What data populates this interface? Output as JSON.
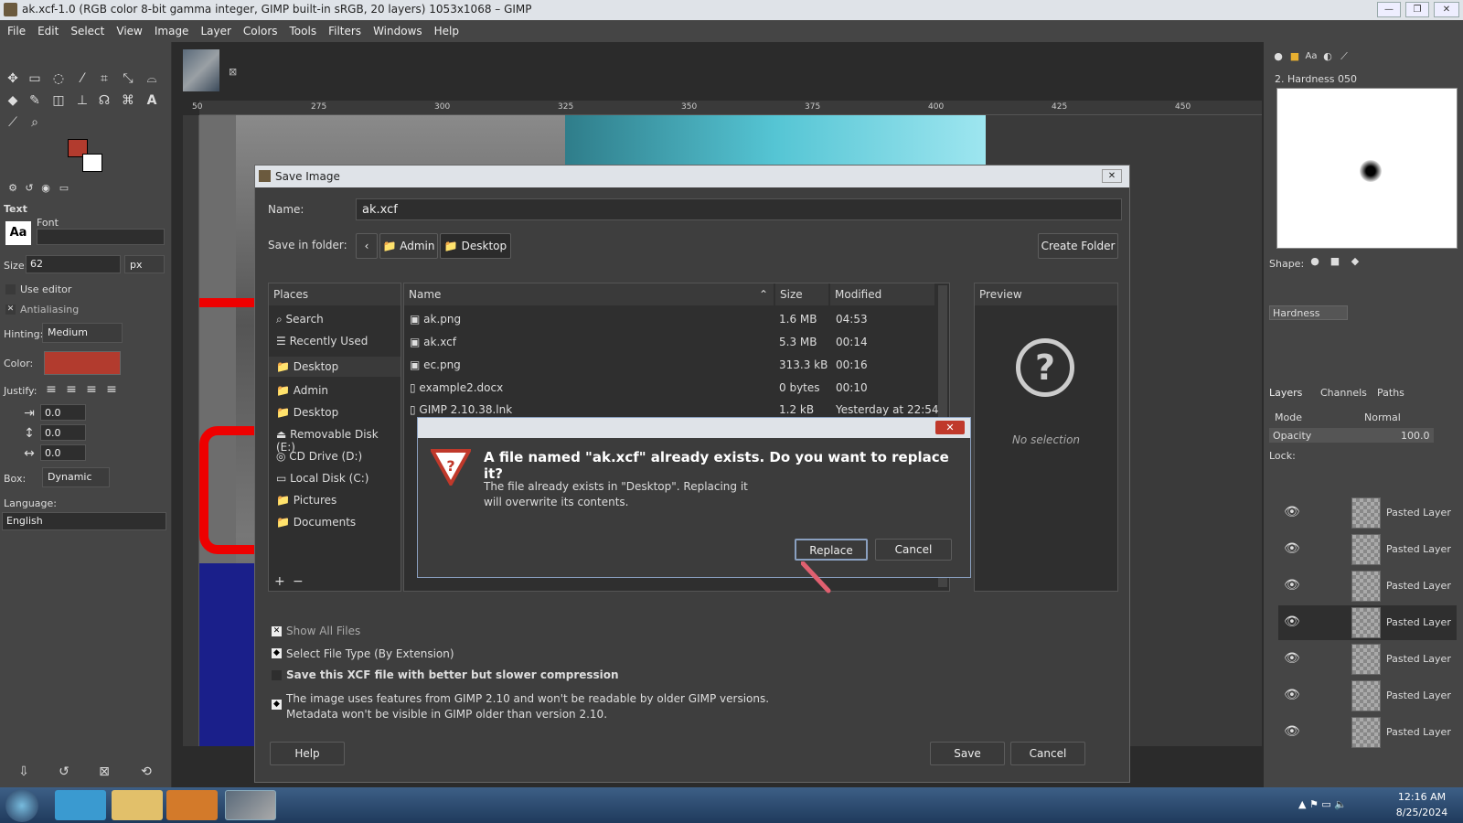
{
  "window": {
    "title": "ak.xcf-1.0 (RGB color 8-bit gamma integer, GIMP built-in sRGB, 20 layers) 1053x1068 – GIMP"
  },
  "menu": [
    "File",
    "Edit",
    "Select",
    "View",
    "Image",
    "Layer",
    "Colors",
    "Tools",
    "Filters",
    "Windows",
    "Help"
  ],
  "ruler": {
    "marks": [
      "50",
      "275",
      "300",
      "325",
      "350",
      "375",
      "400",
      "425",
      "450"
    ]
  },
  "tool_options": {
    "title": "Text",
    "font_label": "Font",
    "size_label": "Size:",
    "size_value": "62",
    "size_unit": "px",
    "use_editor": "Use editor",
    "antialiasing": "Antialiasing",
    "hinting_label": "Hinting:",
    "hinting_value": "Medium",
    "color_label": "Color:",
    "justify_label": "Justify:",
    "indent": "0.0",
    "line_spacing": "0.0",
    "letter_spacing": "0.0",
    "box_label": "Box:",
    "box_value": "Dynamic",
    "language_label": "Language:",
    "language_value": "English"
  },
  "brushes": {
    "title": "2. Hardness 050",
    "shape_label": "Shape:",
    "hardness_label": "Hardness"
  },
  "layers": {
    "tabs": [
      "Layers",
      "Channels",
      "Paths"
    ],
    "mode_label": "Mode",
    "mode_value": "Normal",
    "opacity_label": "Opacity",
    "opacity_value": "100.0",
    "lock_label": "Lock:",
    "items": [
      "Pasted Layer",
      "Pasted Layer",
      "Pasted Layer",
      "Pasted Layer",
      "Pasted Layer",
      "Pasted Layer",
      "Pasted Layer"
    ]
  },
  "save_dialog": {
    "title": "Save Image",
    "name_label": "Name:",
    "name_value": "ak.xcf",
    "folder_label": "Save in folder:",
    "crumbs": [
      "Admin",
      "Desktop"
    ],
    "create_folder": "Create Folder",
    "places_header": "Places",
    "places": [
      "Search",
      "Recently Used",
      "Desktop",
      "Admin",
      "Desktop",
      "Removable Disk (E:)",
      "CD Drive (D:)",
      "Local Disk (C:)",
      "Pictures",
      "Documents"
    ],
    "columns": {
      "name": "Name",
      "size": "Size",
      "modified": "Modified"
    },
    "files": [
      {
        "name": "ak.png",
        "size": "1.6 MB",
        "modified": "04:53"
      },
      {
        "name": "ak.xcf",
        "size": "5.3 MB",
        "modified": "00:14"
      },
      {
        "name": "ec.png",
        "size": "313.3 kB",
        "modified": "00:16"
      },
      {
        "name": "example2.docx",
        "size": "0 bytes",
        "modified": "00:10"
      },
      {
        "name": "GIMP 2.10.38.lnk",
        "size": "1.2 kB",
        "modified": "Yesterday at 22:54"
      }
    ],
    "preview_header": "Preview",
    "no_selection": "No selection",
    "show_all": "Show All Files",
    "select_type": "Select File Type (By Extension)",
    "compression": "Save this XCF file with better but slower compression",
    "info1": "The image uses features from GIMP 2.10 and won't be readable by older GIMP versions.",
    "info2": "Metadata won't be visible in GIMP older than version 2.10.",
    "help": "Help",
    "save": "Save",
    "cancel": "Cancel"
  },
  "alert": {
    "title": "A file named \"ak.xcf\" already exists.  Do you want to replace it?",
    "body1": "The file already exists in \"Desktop\".  Replacing it",
    "body2": "will overwrite its contents.",
    "replace": "Replace",
    "cancel": "Cancel"
  },
  "taskbar": {
    "time": "12:16 AM",
    "date": "8/25/2024"
  }
}
